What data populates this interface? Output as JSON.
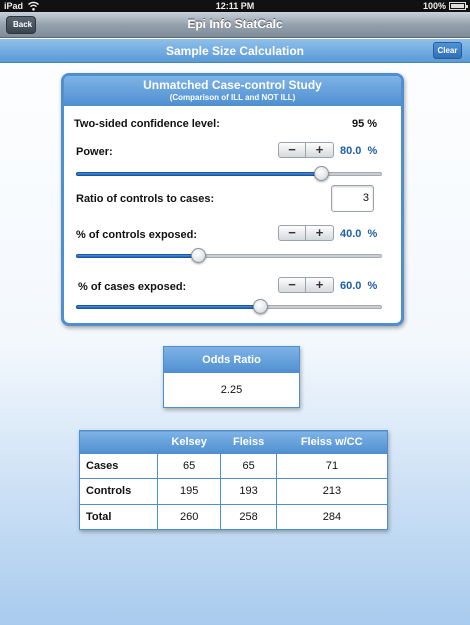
{
  "status_bar": {
    "device": "iPad",
    "time": "12:11 PM",
    "battery": "100%"
  },
  "nav": {
    "back_label": "Back",
    "title": "Epi Info StatCalc"
  },
  "subheader": {
    "title": "Sample Size Calculation",
    "clear_label": "Clear"
  },
  "study": {
    "title": "Unmatched Case-control Study",
    "subtitle": "(Comparison of ILL and NOT ILL)",
    "confidence": {
      "label": "Two-sided confidence level:",
      "value": "95 %"
    },
    "power": {
      "label": "Power:",
      "value": "80.0",
      "unit": "%",
      "level": 0.8
    },
    "ratio": {
      "label": "Ratio of controls to cases:",
      "value": "3"
    },
    "controls_exposed": {
      "label": "% of controls exposed:",
      "value": "40.0",
      "unit": "%",
      "level": 0.4
    },
    "cases_exposed": {
      "label": "% of cases exposed:",
      "value": "60.0",
      "unit": "%",
      "level": 0.6
    }
  },
  "odds_ratio": {
    "label": "Odds Ratio",
    "value": "2.25"
  },
  "results": {
    "headers": [
      "",
      "Kelsey",
      "Fleiss",
      "Fleiss w/CC"
    ],
    "rows": [
      {
        "label": "Cases",
        "values": [
          "65",
          "65",
          "71"
        ]
      },
      {
        "label": "Controls",
        "values": [
          "195",
          "193",
          "213"
        ]
      },
      {
        "label": "Total",
        "values": [
          "260",
          "258",
          "284"
        ]
      }
    ]
  }
}
